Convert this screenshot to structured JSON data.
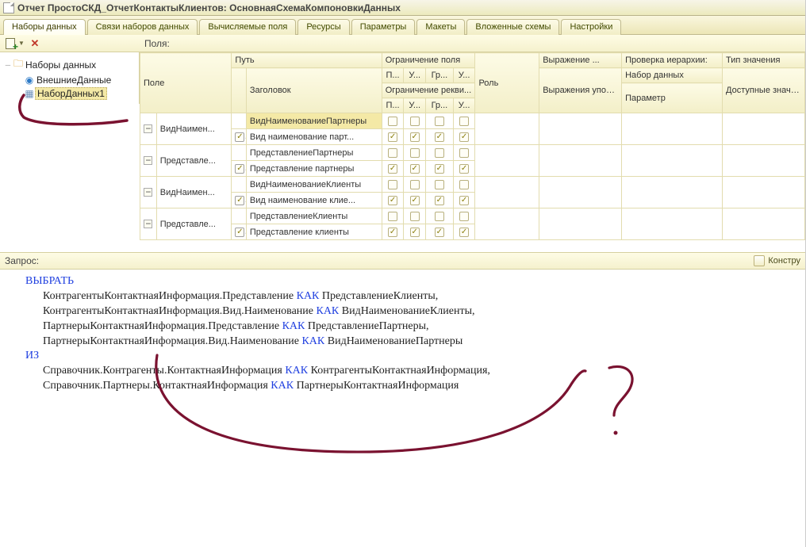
{
  "window": {
    "title": "Отчет ПростоСКД_ОтчетКонтактыКлиентов: ОсновнаяСхемаКомпоновкиДанных"
  },
  "tabs": [
    {
      "label": "Наборы данных",
      "active": true
    },
    {
      "label": "Связи наборов данных"
    },
    {
      "label": "Вычисляемые поля"
    },
    {
      "label": "Ресурсы"
    },
    {
      "label": "Параметры"
    },
    {
      "label": "Макеты"
    },
    {
      "label": "Вложенные схемы"
    },
    {
      "label": "Настройки"
    }
  ],
  "tree": {
    "root": "Наборы данных",
    "items": [
      {
        "label": "ВнешниеДанные",
        "icon": "globe"
      },
      {
        "label": "НаборДанных1",
        "icon": "grid",
        "selected": true
      }
    ]
  },
  "fields": {
    "panel_label": "Поля:",
    "headers": {
      "field": "Поле",
      "path": "Путь",
      "title": "Заголовок",
      "restr_field": "Ограничение поля",
      "restr_detail": "Ограничение рекви...",
      "p": "П...",
      "u": "У...",
      "gr": "Гр...",
      "u2": "У...",
      "role": "Роль",
      "expr": "Выражение ...",
      "expr_order": "Выражения упорядочива...",
      "hier": "Проверка иерархии:",
      "hier_set": "Набор данных",
      "hier_param": "Параметр",
      "valtype": "Тип значения",
      "avail": "Доступные значения"
    },
    "rows": [
      {
        "field": "ВидНаимен...",
        "path": "ВидНаименованиеПартнеры",
        "title": "Вид наименование парт...",
        "sel": true
      },
      {
        "field": "Представле...",
        "path": "ПредставлениеПартнеры",
        "title": "Представление партнеры"
      },
      {
        "field": "ВидНаимен...",
        "path": "ВидНаименованиеКлиенты",
        "title": "Вид наименование клие..."
      },
      {
        "field": "Представле...",
        "path": "ПредставлениеКлиенты",
        "title": "Представление клиенты"
      }
    ]
  },
  "query": {
    "label": "Запрос:",
    "constructor": "Констру",
    "text": [
      {
        "kw": "ВЫБРАТЬ"
      },
      {
        "indent": true,
        "parts": [
          "КонтрагентыКонтактнаяИнформация.Представление ",
          {
            "kw": "КАК"
          },
          " ПредставлениеКлиенты,"
        ]
      },
      {
        "indent": true,
        "parts": [
          "КонтрагентыКонтактнаяИнформация.Вид.Наименование ",
          {
            "kw": "КАК"
          },
          " ВидНаименованиеКлиенты,"
        ]
      },
      {
        "indent": true,
        "parts": [
          "ПартнерыКонтактнаяИнформация.Представление ",
          {
            "kw": "КАК"
          },
          " ПредставлениеПартнеры,"
        ]
      },
      {
        "indent": true,
        "parts": [
          "ПартнерыКонтактнаяИнформация.Вид.Наименование ",
          {
            "kw": "КАК"
          },
          " ВидНаименованиеПартнеры"
        ]
      },
      {
        "kw": "ИЗ"
      },
      {
        "indent": true,
        "parts": [
          "Справочник.Контрагенты.КонтактнаяИнформация ",
          {
            "kw": "КАК"
          },
          " КонтрагентыКонтактнаяИнформация,"
        ]
      },
      {
        "indent": true,
        "parts": [
          "Справочник.Партнеры.КонтактнаяИнформация ",
          {
            "kw": "КАК"
          },
          " ПартнерыКонтактнаяИнформация"
        ]
      }
    ]
  }
}
